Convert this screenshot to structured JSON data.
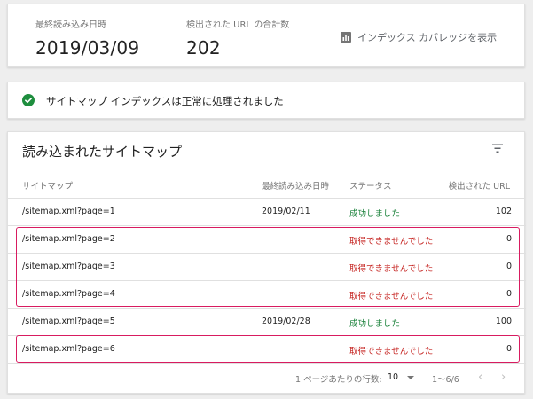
{
  "summary": {
    "last_read_label": "最終読み込み日時",
    "last_read_value": "2019/03/09",
    "urls_label": "検出された URL の合計数",
    "urls_value": "202",
    "coverage_link": "インデックス カバレッジを表示",
    "coverage_icon": "bar-chart-icon"
  },
  "status": {
    "icon": "check-circle-icon",
    "message": "サイトマップ インデックスは正常に処理されました",
    "color": "#1e8e3e"
  },
  "table": {
    "title": "読み込まれたサイトマップ",
    "filter_icon": "filter-icon",
    "columns": [
      "サイトマップ",
      "最終読み込み日時",
      "ステータス",
      "検出された URL"
    ],
    "rows": [
      {
        "sitemap": "/sitemap.xml?page=1",
        "date": "2019/02/11",
        "status": "成功しました",
        "count": "102",
        "state": "ok"
      },
      {
        "sitemap": "/sitemap.xml?page=2",
        "date": "",
        "status": "取得できませんでした",
        "count": "0",
        "state": "err"
      },
      {
        "sitemap": "/sitemap.xml?page=3",
        "date": "",
        "status": "取得できませんでした",
        "count": "0",
        "state": "err"
      },
      {
        "sitemap": "/sitemap.xml?page=4",
        "date": "",
        "status": "取得できませんでした",
        "count": "0",
        "state": "err"
      },
      {
        "sitemap": "/sitemap.xml?page=5",
        "date": "2019/02/28",
        "status": "成功しました",
        "count": "100",
        "state": "ok"
      },
      {
        "sitemap": "/sitemap.xml?page=6",
        "date": "",
        "status": "取得できませんでした",
        "count": "0",
        "state": "err"
      }
    ],
    "footer": {
      "rows_per_page_label": "1 ページあたりの行数:",
      "rows_per_page_value": "10",
      "range": "1〜6/6",
      "prev_icon": "chevron-left-icon",
      "next_icon": "chevron-right-icon"
    }
  },
  "colors": {
    "success": "#188038",
    "error": "#c5221f",
    "highlight": "#d81b60"
  }
}
